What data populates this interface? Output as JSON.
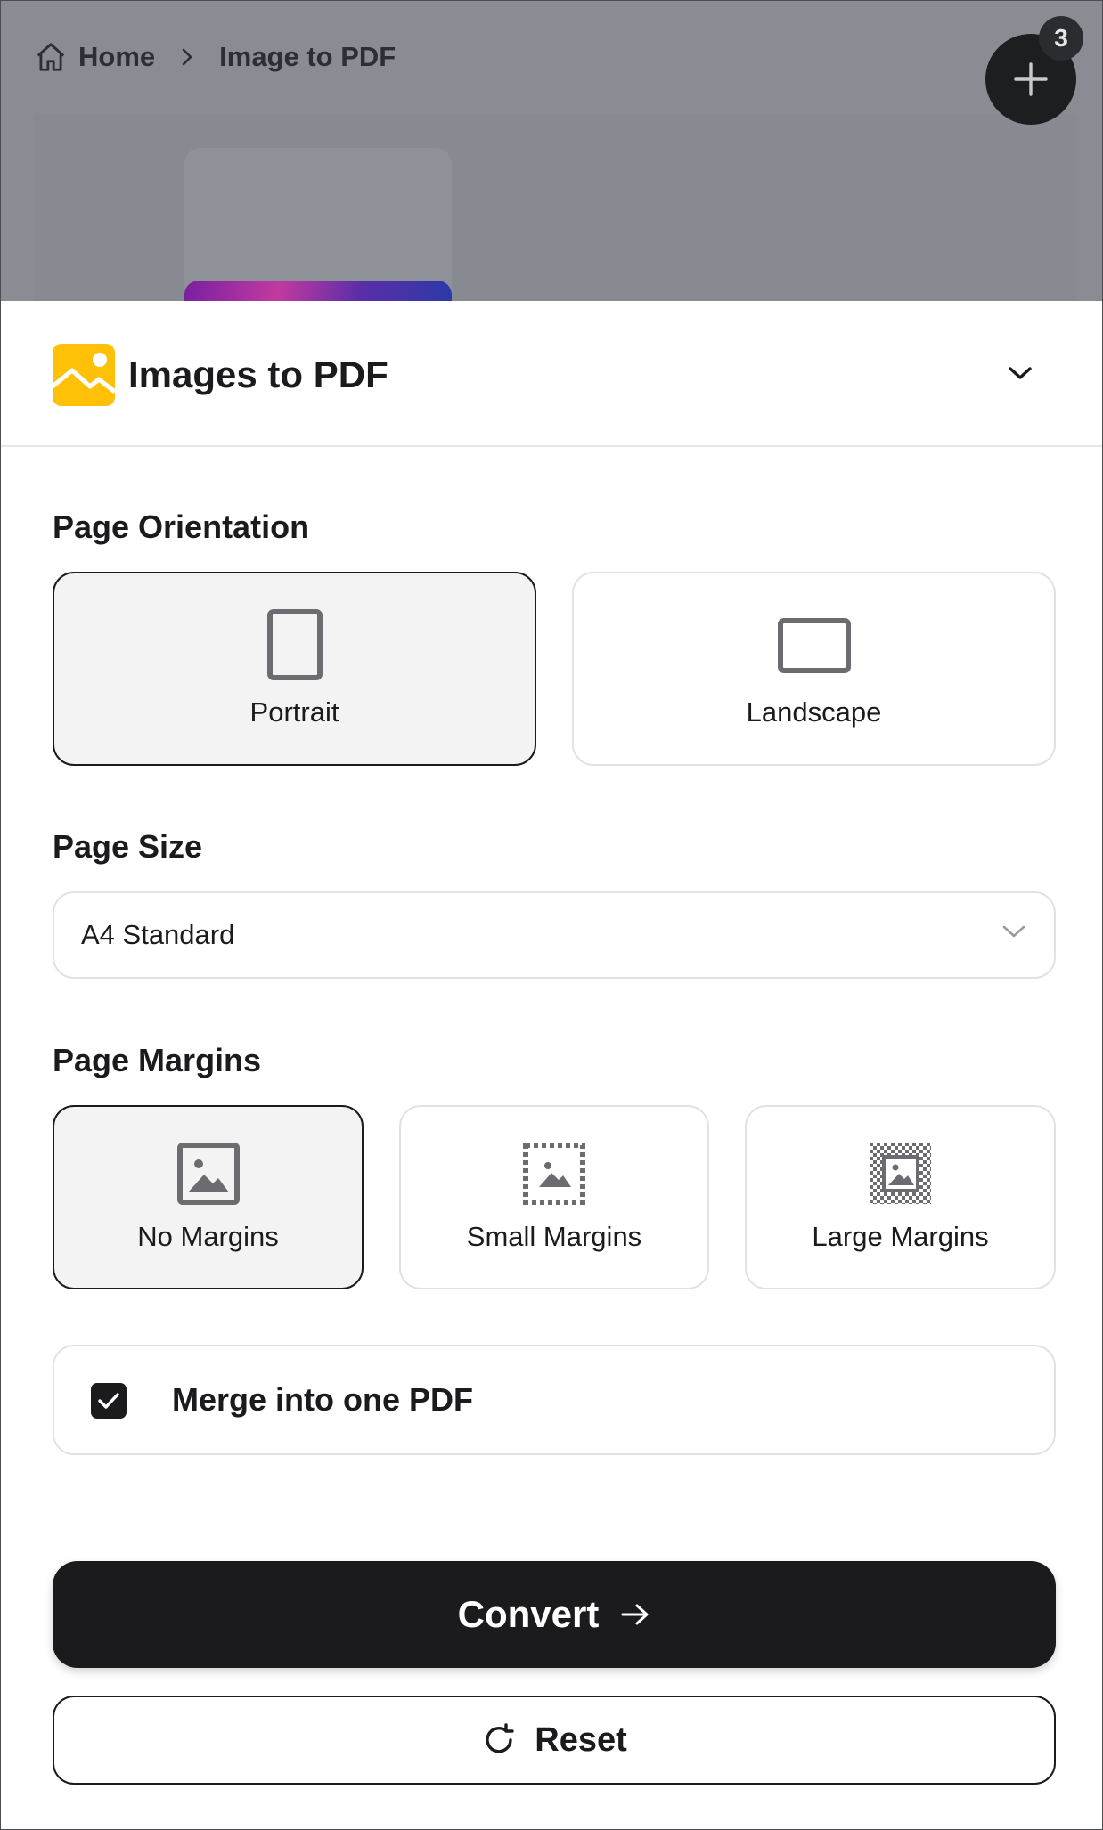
{
  "breadcrumb": {
    "home_label": "Home",
    "home_icon": "home-icon",
    "separator_icon": "chevron-right-icon",
    "current_label": "Image to PDF"
  },
  "fab": {
    "icon": "plus-icon",
    "badge_count": "3"
  },
  "sheet": {
    "title": "Images to PDF",
    "title_icon": "image-icon",
    "collapse_icon": "chevron-down-icon"
  },
  "orientation": {
    "label": "Page Orientation",
    "options": [
      {
        "label": "Portrait",
        "icon": "portrait-page-icon",
        "selected": true
      },
      {
        "label": "Landscape",
        "icon": "landscape-page-icon",
        "selected": false
      }
    ]
  },
  "page_size": {
    "label": "Page Size",
    "value": "A4 Standard",
    "icon": "chevron-down-icon"
  },
  "margins": {
    "label": "Page Margins",
    "options": [
      {
        "label": "No Margins",
        "icon": "no-margins-icon",
        "selected": true
      },
      {
        "label": "Small Margins",
        "icon": "small-margins-icon",
        "selected": false
      },
      {
        "label": "Large Margins",
        "icon": "large-margins-icon",
        "selected": false
      }
    ]
  },
  "merge": {
    "label": "Merge into one PDF",
    "checked": true
  },
  "actions": {
    "convert_label": "Convert",
    "convert_icon": "arrow-right-icon",
    "reset_label": "Reset",
    "reset_icon": "refresh-icon"
  },
  "colors": {
    "accent": "#1b1b1d",
    "app_icon": "#ffc107",
    "selected_bg": "#f3f3f3",
    "overlay": "#8a8c93"
  }
}
